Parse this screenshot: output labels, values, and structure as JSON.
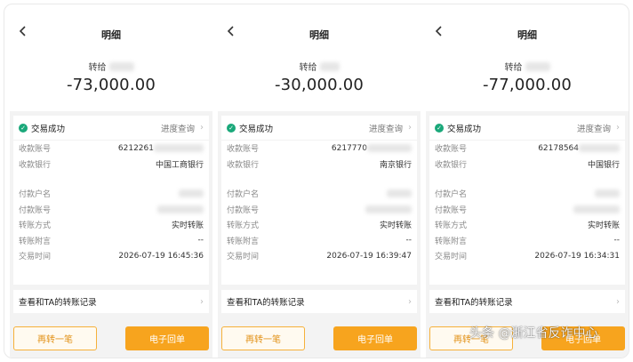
{
  "panels": [
    {
      "title": "明细",
      "recipient_prefix": "转给",
      "amount": "-73,000.00",
      "status": "交易成功",
      "progress_query": "进度查询",
      "payee_account_label": "收款账号",
      "payee_account": "6212261",
      "payee_bank_label": "收款银行",
      "payee_bank": "中国工商银行",
      "payer_name_label": "付款户名",
      "payer_account_label": "付款账号",
      "method_label": "转账方式",
      "method": "实时转账",
      "note_label": "转账附言",
      "note": "--",
      "time_label": "交易时间",
      "time": "2026-07-19 16:45:36",
      "records": "查看和TA的转账记录",
      "btn_again": "再转一笔",
      "btn_receipt": "电子回单"
    },
    {
      "title": "明细",
      "recipient_prefix": "转给",
      "amount": "-30,000.00",
      "status": "交易成功",
      "progress_query": "进度查询",
      "payee_account_label": "收款账号",
      "payee_account": "6217770",
      "payee_bank_label": "收款银行",
      "payee_bank": "南京银行",
      "payer_name_label": "付款户名",
      "payer_account_label": "付款账号",
      "method_label": "转账方式",
      "method": "实时转账",
      "note_label": "转账附言",
      "note": "--",
      "time_label": "交易时间",
      "time": "2026-07-19 16:39:47",
      "records": "查看和TA的转账记录",
      "btn_again": "再转一笔",
      "btn_receipt": "电子回单"
    },
    {
      "title": "明细",
      "recipient_prefix": "转给",
      "amount": "-77,000.00",
      "status": "交易成功",
      "progress_query": "进度查询",
      "payee_account_label": "收款账号",
      "payee_account": "62178564",
      "payee_bank_label": "收款银行",
      "payee_bank": "中国银行",
      "payer_name_label": "付款户名",
      "payer_account_label": "付款账号",
      "method_label": "转账方式",
      "method": "实时转账",
      "note_label": "转账附言",
      "note": "--",
      "time_label": "交易时间",
      "time": "2026-07-19 16:34:31",
      "records": "查看和TA的转账记录",
      "btn_again": "再转一笔",
      "btn_receipt": "电子回单"
    }
  ],
  "watermark": "头条 @浙江省反诈中心",
  "colors": {
    "success": "#1aa87a",
    "accent": "#f7a41e"
  }
}
